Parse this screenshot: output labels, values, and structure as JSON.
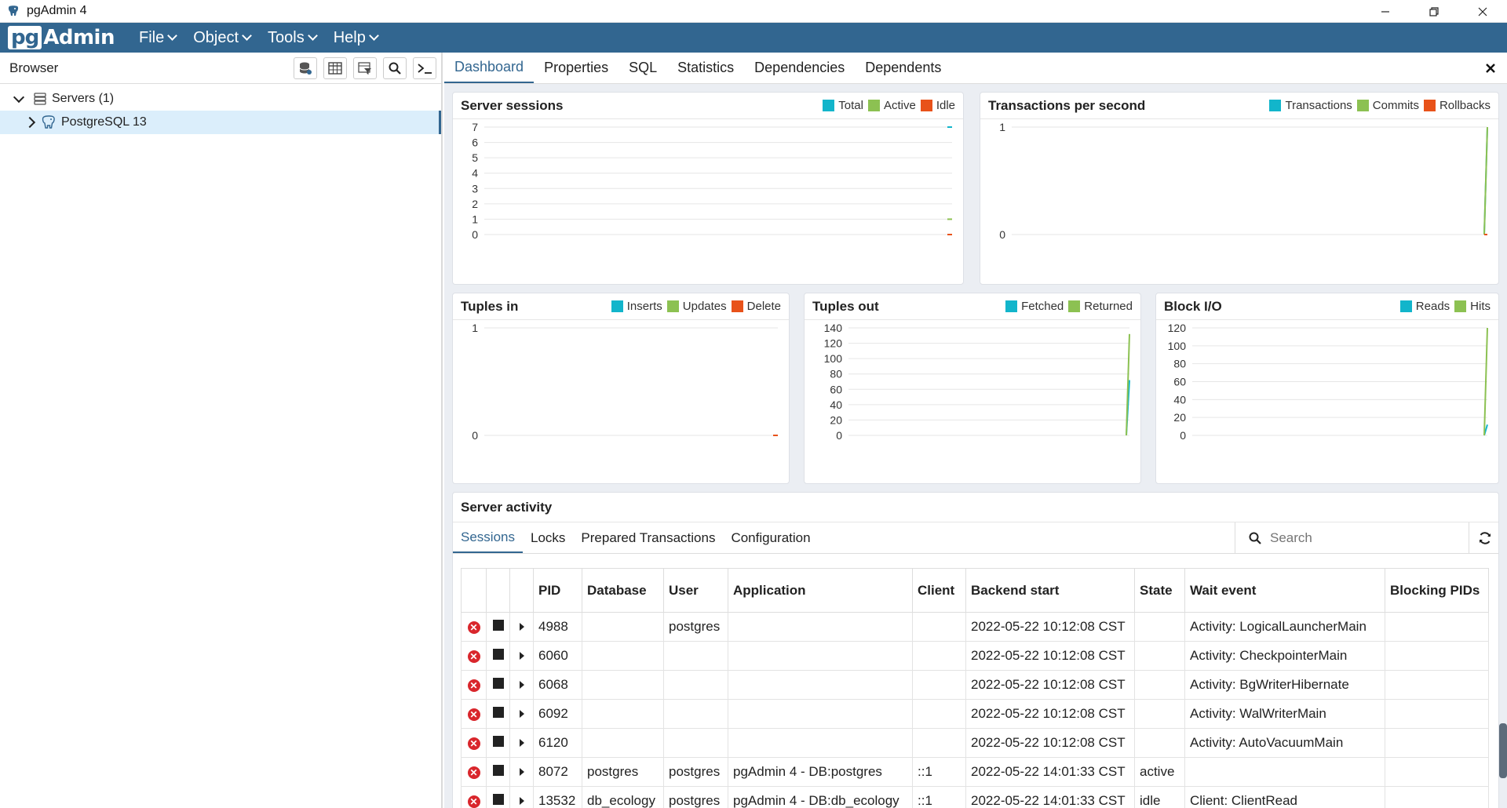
{
  "window": {
    "title": "pgAdmin 4"
  },
  "menubar": {
    "brand_pg": "pg",
    "brand_admin": "Admin",
    "items": [
      {
        "label": "File"
      },
      {
        "label": "Object"
      },
      {
        "label": "Tools"
      },
      {
        "label": "Help"
      }
    ]
  },
  "browser": {
    "title": "Browser",
    "tree": {
      "servers_label": "Servers (1)",
      "server_label": "PostgreSQL 13"
    }
  },
  "tabs": [
    {
      "label": "Dashboard"
    },
    {
      "label": "Properties"
    },
    {
      "label": "SQL"
    },
    {
      "label": "Statistics"
    },
    {
      "label": "Dependencies"
    },
    {
      "label": "Dependents"
    }
  ],
  "colors": {
    "brand": "#326690",
    "cyan": "#12b5cb",
    "green": "#8cc152",
    "red": "#e8521a"
  },
  "charts": {
    "server_sessions": {
      "title": "Server sessions",
      "legend": [
        "Total",
        "Active",
        "Idle"
      ]
    },
    "tps": {
      "title": "Transactions per second",
      "legend": [
        "Transactions",
        "Commits",
        "Rollbacks"
      ]
    },
    "tuples_in": {
      "title": "Tuples in",
      "legend": [
        "Inserts",
        "Updates",
        "Delete"
      ]
    },
    "tuples_out": {
      "title": "Tuples out",
      "legend": [
        "Fetched",
        "Returned"
      ]
    },
    "block_io": {
      "title": "Block I/O",
      "legend": [
        "Reads",
        "Hits"
      ]
    }
  },
  "chart_data": [
    {
      "type": "line",
      "title": "Server sessions",
      "ylim": [
        0,
        7
      ],
      "yticks": [
        "0",
        "1",
        "2",
        "3",
        "4",
        "5",
        "6",
        "7"
      ],
      "series": [
        {
          "name": "Total",
          "values": [
            7
          ]
        },
        {
          "name": "Active",
          "values": [
            1
          ]
        },
        {
          "name": "Idle",
          "values": [
            0
          ]
        }
      ]
    },
    {
      "type": "line",
      "title": "Transactions per second",
      "ylim": [
        0,
        1
      ],
      "yticks": [
        "0",
        "1"
      ],
      "series": [
        {
          "name": "Transactions",
          "values": [
            0,
            1
          ]
        },
        {
          "name": "Commits",
          "values": [
            0,
            1
          ]
        },
        {
          "name": "Rollbacks",
          "values": [
            0,
            0
          ]
        }
      ]
    },
    {
      "type": "line",
      "title": "Tuples in",
      "ylim": [
        0,
        1
      ],
      "yticks": [
        "0",
        "1"
      ],
      "series": [
        {
          "name": "Inserts",
          "values": [
            0
          ]
        },
        {
          "name": "Updates",
          "values": [
            0
          ]
        },
        {
          "name": "Delete",
          "values": [
            0
          ]
        }
      ]
    },
    {
      "type": "line",
      "title": "Tuples out",
      "ylim": [
        0,
        140
      ],
      "yticks": [
        "0",
        "20",
        "40",
        "60",
        "80",
        "100",
        "120",
        "140"
      ],
      "series": [
        {
          "name": "Fetched",
          "values": [
            0,
            72
          ]
        },
        {
          "name": "Returned",
          "values": [
            0,
            132
          ]
        }
      ]
    },
    {
      "type": "line",
      "title": "Block I/O",
      "ylim": [
        0,
        120
      ],
      "yticks": [
        "0",
        "20",
        "40",
        "60",
        "80",
        "100",
        "120"
      ],
      "series": [
        {
          "name": "Reads",
          "values": [
            0,
            12
          ]
        },
        {
          "name": "Hits",
          "values": [
            0,
            120
          ]
        }
      ]
    }
  ],
  "activity": {
    "title": "Server activity",
    "subtabs": [
      {
        "label": "Sessions"
      },
      {
        "label": "Locks"
      },
      {
        "label": "Prepared Transactions"
      },
      {
        "label": "Configuration"
      }
    ],
    "search_placeholder": "Search",
    "columns": [
      "PID",
      "Database",
      "User",
      "Application",
      "Client",
      "Backend start",
      "State",
      "Wait event",
      "Blocking PIDs"
    ],
    "rows": [
      [
        "4988",
        "",
        "postgres",
        "",
        "",
        "2022-05-22 10:12:08 CST",
        "",
        "Activity: LogicalLauncherMain",
        ""
      ],
      [
        "6060",
        "",
        "",
        "",
        "",
        "2022-05-22 10:12:08 CST",
        "",
        "Activity: CheckpointerMain",
        ""
      ],
      [
        "6068",
        "",
        "",
        "",
        "",
        "2022-05-22 10:12:08 CST",
        "",
        "Activity: BgWriterHibernate",
        ""
      ],
      [
        "6092",
        "",
        "",
        "",
        "",
        "2022-05-22 10:12:08 CST",
        "",
        "Activity: WalWriterMain",
        ""
      ],
      [
        "6120",
        "",
        "",
        "",
        "",
        "2022-05-22 10:12:08 CST",
        "",
        "Activity: AutoVacuumMain",
        ""
      ],
      [
        "8072",
        "postgres",
        "postgres",
        "pgAdmin 4 - DB:postgres",
        "::1",
        "2022-05-22 14:01:33 CST",
        "active",
        "",
        ""
      ],
      [
        "13532",
        "db_ecology",
        "postgres",
        "pgAdmin 4 - DB:db_ecology",
        "::1",
        "2022-05-22 14:01:33 CST",
        "idle",
        "Client: ClientRead",
        ""
      ]
    ]
  }
}
